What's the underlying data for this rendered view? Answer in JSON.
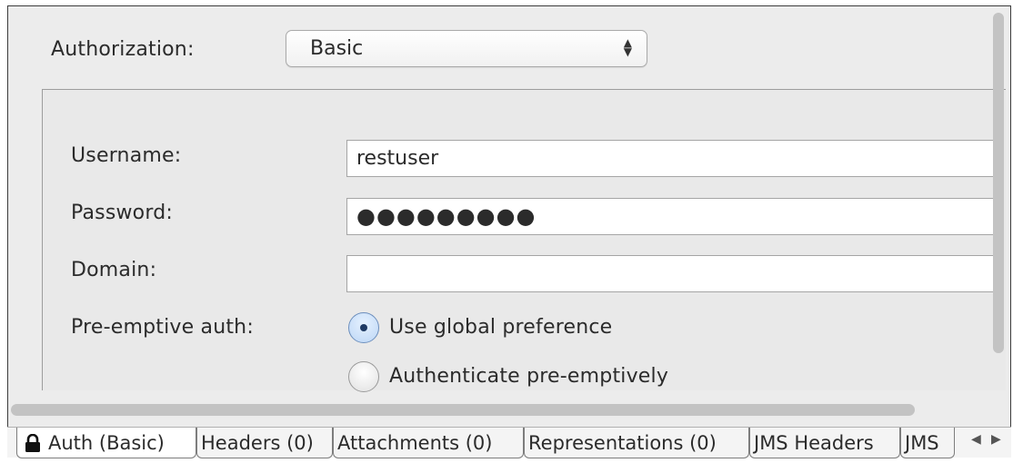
{
  "authorization": {
    "label": "Authorization:",
    "selected": "Basic",
    "select_arrows": "▲\n▼"
  },
  "form": {
    "username_label": "Username:",
    "username_value": "restuser",
    "password_label": "Password:",
    "password_value": "●●●●●●●●●",
    "domain_label": "Domain:",
    "domain_value": "",
    "preemptive_label": "Pre-emptive auth:",
    "radio_options": [
      {
        "label": "Use global preference",
        "selected": true
      },
      {
        "label": "Authenticate pre-emptively",
        "selected": false
      }
    ]
  },
  "tabs": [
    {
      "label": "Auth (Basic)",
      "active": true,
      "icon": "lock-icon"
    },
    {
      "label": "Headers (0)",
      "active": false
    },
    {
      "label": "Attachments (0)",
      "active": false
    },
    {
      "label": "Representations (0)",
      "active": false
    },
    {
      "label": "JMS Headers",
      "active": false
    },
    {
      "label": "JMS",
      "active": false
    }
  ],
  "tab_scroll": {
    "left": "◀",
    "right": "▶"
  },
  "colors": {
    "frame_border": "#3c3c3c",
    "panel_bg": "#e9e9e9",
    "radio_dot": "#1f3a63"
  }
}
